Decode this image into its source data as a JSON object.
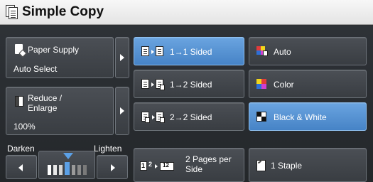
{
  "title": "Simple Copy",
  "paper_supply": {
    "label": "Paper Supply",
    "value": "Auto Select"
  },
  "reduce_enlarge": {
    "label_line1": "Reduce /",
    "label_line2": "Enlarge",
    "value": "100%"
  },
  "density": {
    "darken_label": "Darken",
    "lighten_label": "Lighten",
    "level": 0.5
  },
  "sided": {
    "options": [
      {
        "label": "1→1 Sided",
        "selected": true
      },
      {
        "label": "1→2 Sided",
        "selected": false
      },
      {
        "label": "2→2 Sided",
        "selected": false
      }
    ]
  },
  "pages_per_side": {
    "label_line1": "2 Pages per",
    "label_line2": "Side",
    "icon_num1": "1",
    "icon_num2": "2",
    "icon_num3": "12"
  },
  "color_mode": {
    "options": [
      {
        "label": "Auto",
        "selected": false
      },
      {
        "label": "Color",
        "selected": false
      },
      {
        "label": "Black & White",
        "selected": true
      }
    ]
  },
  "staple": {
    "label": "1 Staple"
  },
  "colors": {
    "accent": "#4f8fd4",
    "panel": "#2b2e31",
    "button": "#43474c"
  }
}
